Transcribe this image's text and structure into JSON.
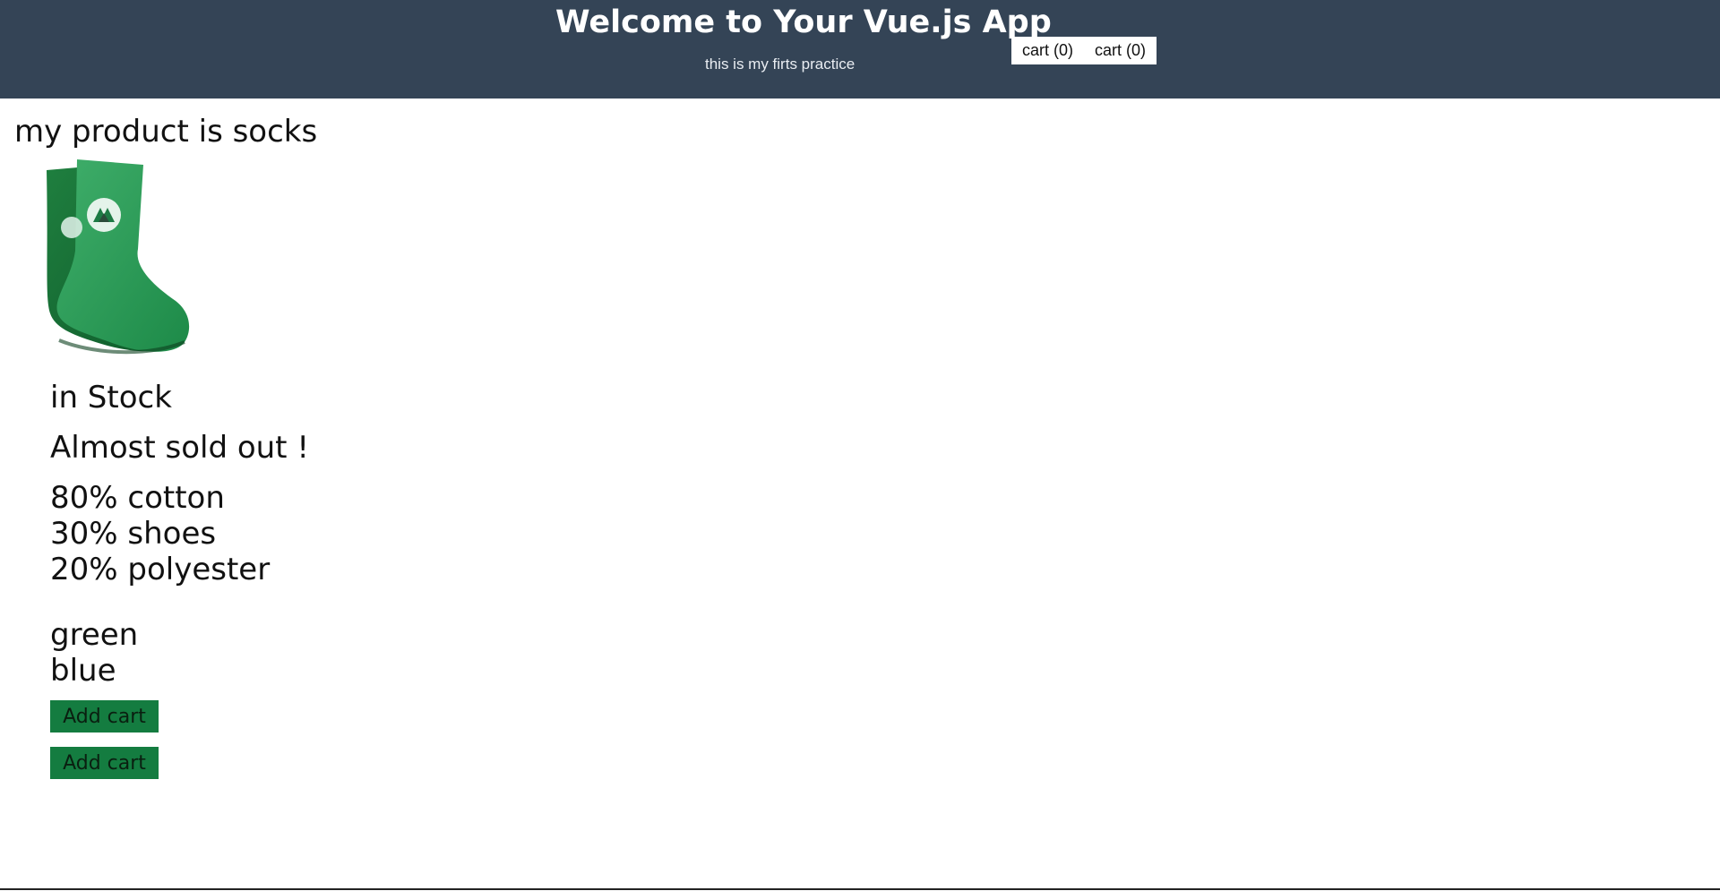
{
  "header": {
    "title": "Welcome to Your Vue.js App",
    "subtitle": "this is my firts practice",
    "carts": [
      "cart (0)",
      "cart (0)"
    ],
    "background_color": "#344456"
  },
  "product": {
    "title": "my product is socks",
    "image_icon": "green-sock-image",
    "stock_status": "in Stock",
    "stock_message": "Almost sold out !",
    "details": [
      "80% cotton",
      "30% shoes",
      "20% polyester"
    ],
    "variants": [
      "green",
      "blue"
    ],
    "buttons": [
      "Add cart",
      "Add cart"
    ],
    "button_color": "#147c40"
  }
}
